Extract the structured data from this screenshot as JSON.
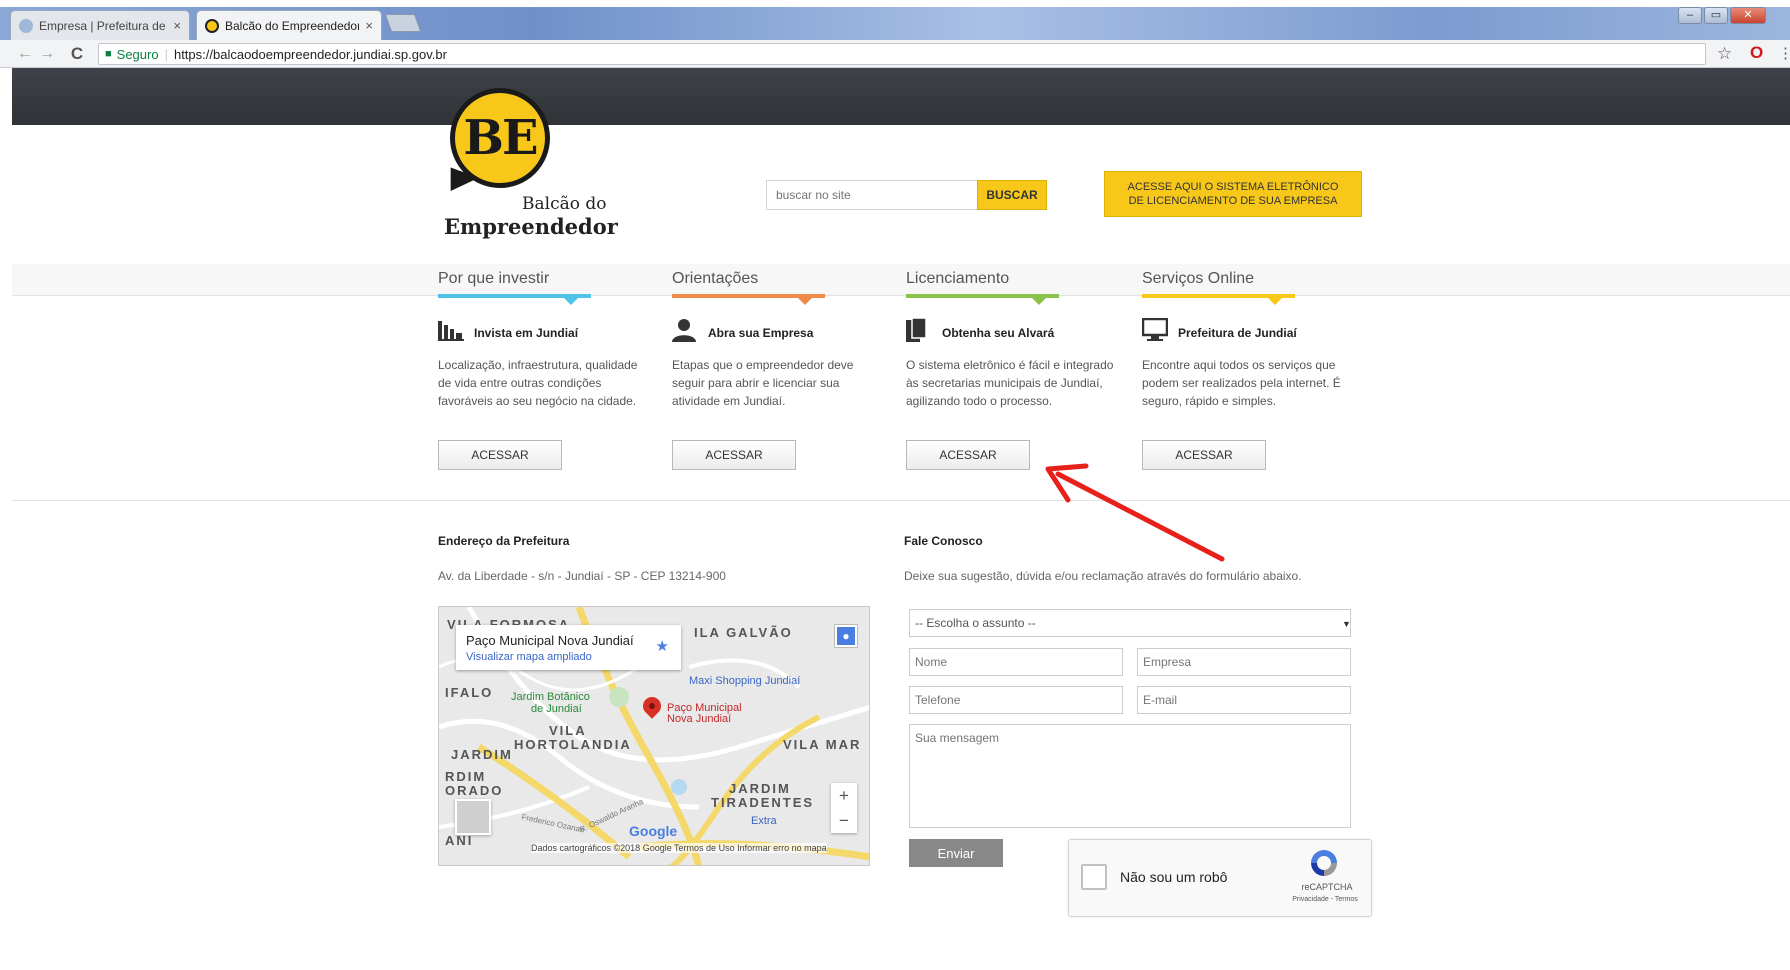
{
  "browser": {
    "tabs": [
      {
        "label": "Empresa | Prefeitura de J",
        "close": "×",
        "active": false
      },
      {
        "label": "Balcão do Empreendedor",
        "close": "×",
        "active": true
      }
    ],
    "nav": {
      "back": "←",
      "forward": "→",
      "reload": "C"
    },
    "address": {
      "secure_label": "Seguro",
      "separator": "|",
      "url": "https://balcaodoempreendedor.jundiai.sp.gov.br"
    },
    "window_controls": [
      "‒",
      "▭",
      "✕"
    ]
  },
  "header": {
    "logo": {
      "initials": "BE",
      "line1": "Balcão do",
      "line2": "Empreendedor"
    },
    "search": {
      "placeholder": "buscar no site",
      "button": "BUSCAR"
    },
    "system_button": "ACESSE AQUI O SISTEMA ELETRÔNICO DE LICENCIAMENTO DE SUA EMPRESA"
  },
  "columns": [
    {
      "title": "Por que investir",
      "subtitle": "Invista em Jundiaí",
      "icon": "chart-icon",
      "color": "#4fc3e8",
      "description": "Localização, infraestrutura, qualidade de vida entre outras condições favoráveis ao seu negócio na cidade.",
      "button": "ACESSAR"
    },
    {
      "title": "Orientações",
      "subtitle": "Abra sua Empresa",
      "icon": "user-icon",
      "color": "#f08a4b",
      "description": "Etapas que o empreendedor deve seguir para abrir e licenciar sua atividade em Jundiaí.",
      "button": "ACESSAR"
    },
    {
      "title": "Licenciamento",
      "subtitle": "Obtenha seu Alvará",
      "icon": "document-icon",
      "color": "#8bc34a",
      "description": "O sistema eletrônico é fácil e integrado às secretarias municipais de Jundiaí, agilizando todo o processo.",
      "button": "ACESSAR"
    },
    {
      "title": "Serviços Online",
      "subtitle": "Prefeitura de Jundiaí",
      "icon": "monitor-icon",
      "color": "#f7c81a",
      "description": "Encontre aqui todos os serviços que podem ser realizados pela internet. É seguro, rápido e simples.",
      "button": "ACESSAR"
    }
  ],
  "address_section": {
    "title": "Endereço da Prefeitura",
    "text": "Av. da Liberdade - s/n - Jundiaí - SP - CEP 13214-900"
  },
  "map": {
    "card_title": "Paço Municipal Nova Jundiaí",
    "card_link": "Visualizar mapa ampliado",
    "labels": [
      "VILA FORMOSA",
      "ILA GALVÃO",
      "IFALO",
      "VILA",
      "HORTOLANDIA",
      "JARDIM",
      "RDIM",
      "ORADO",
      "JARDIM",
      "TIRADENTES",
      "VILA MAR",
      "ANI"
    ],
    "pois": [
      "Maxi Shopping Jundiaí",
      "Jardim Botânico",
      "de Jundiaí",
      "Paço Municipal",
      "Nova Jundiaí",
      "Extra"
    ],
    "streets": [
      "Frederico Ozanan",
      "R. Oswaldo Aranha"
    ],
    "zoom_in": "+",
    "zoom_out": "−",
    "brand": "Google",
    "footer": "Dados cartográficos ©2018 Google   Termos de Uso   Informar erro no mapa"
  },
  "contact": {
    "title": "Fale Conosco",
    "text": "Deixe sua sugestão, dúvida e/ou reclamação através do formulário abaixo.",
    "subject_default": "-- Escolha o assunto --",
    "fields": {
      "name": "Nome",
      "company": "Empresa",
      "phone": "Telefone",
      "email": "E-mail",
      "message": "Sua mensagem"
    },
    "submit": "Enviar",
    "captcha": {
      "label": "Não sou um robô",
      "brand": "reCAPTCHA",
      "links": "Privacidade - Termos"
    }
  },
  "annotation": {
    "color": "#e8201a"
  }
}
